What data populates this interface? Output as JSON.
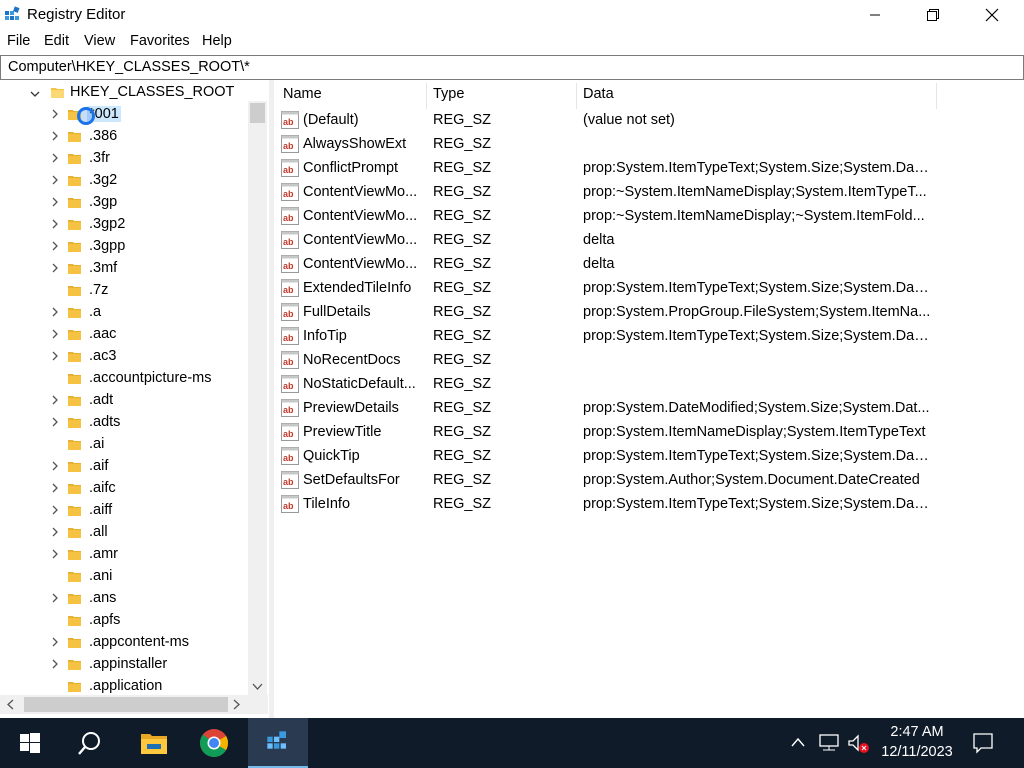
{
  "window": {
    "title": "Registry Editor"
  },
  "menu": [
    "File",
    "Edit",
    "View",
    "Favorites",
    "Help"
  ],
  "address": "Computer\\HKEY_CLASSES_ROOT\\*",
  "tree": {
    "root": "HKEY_CLASSES_ROOT",
    "items": [
      {
        "label": "*001",
        "expandable": true,
        "selected": true
      },
      {
        "label": ".386",
        "expandable": true
      },
      {
        "label": ".3fr",
        "expandable": true
      },
      {
        "label": ".3g2",
        "expandable": true
      },
      {
        "label": ".3gp",
        "expandable": true
      },
      {
        "label": ".3gp2",
        "expandable": true
      },
      {
        "label": ".3gpp",
        "expandable": true
      },
      {
        "label": ".3mf",
        "expandable": true
      },
      {
        "label": ".7z",
        "expandable": false
      },
      {
        "label": ".a",
        "expandable": true
      },
      {
        "label": ".aac",
        "expandable": true
      },
      {
        "label": ".ac3",
        "expandable": true
      },
      {
        "label": ".accountpicture-ms",
        "expandable": false
      },
      {
        "label": ".adt",
        "expandable": true
      },
      {
        "label": ".adts",
        "expandable": true
      },
      {
        "label": ".ai",
        "expandable": false
      },
      {
        "label": ".aif",
        "expandable": true
      },
      {
        "label": ".aifc",
        "expandable": true
      },
      {
        "label": ".aiff",
        "expandable": true
      },
      {
        "label": ".all",
        "expandable": true
      },
      {
        "label": ".amr",
        "expandable": true
      },
      {
        "label": ".ani",
        "expandable": false
      },
      {
        "label": ".ans",
        "expandable": true
      },
      {
        "label": ".apfs",
        "expandable": false
      },
      {
        "label": ".appcontent-ms",
        "expandable": true
      },
      {
        "label": ".appinstaller",
        "expandable": true
      },
      {
        "label": ".application",
        "expandable": false
      }
    ]
  },
  "columns": {
    "name": "Name",
    "type": "Type",
    "data": "Data"
  },
  "values": [
    {
      "name": "(Default)",
      "type": "REG_SZ",
      "data": "(value not set)"
    },
    {
      "name": "AlwaysShowExt",
      "type": "REG_SZ",
      "data": ""
    },
    {
      "name": "ConflictPrompt",
      "type": "REG_SZ",
      "data": "prop:System.ItemTypeText;System.Size;System.Date..."
    },
    {
      "name": "ContentViewMo...",
      "type": "REG_SZ",
      "data": "prop:~System.ItemNameDisplay;System.ItemTypeT..."
    },
    {
      "name": "ContentViewMo...",
      "type": "REG_SZ",
      "data": "prop:~System.ItemNameDisplay;~System.ItemFold..."
    },
    {
      "name": "ContentViewMo...",
      "type": "REG_SZ",
      "data": "delta"
    },
    {
      "name": "ContentViewMo...",
      "type": "REG_SZ",
      "data": "delta"
    },
    {
      "name": "ExtendedTileInfo",
      "type": "REG_SZ",
      "data": "prop:System.ItemTypeText;System.Size;System.Date..."
    },
    {
      "name": "FullDetails",
      "type": "REG_SZ",
      "data": "prop:System.PropGroup.FileSystem;System.ItemNa..."
    },
    {
      "name": "InfoTip",
      "type": "REG_SZ",
      "data": "prop:System.ItemTypeText;System.Size;System.Date..."
    },
    {
      "name": "NoRecentDocs",
      "type": "REG_SZ",
      "data": ""
    },
    {
      "name": "NoStaticDefault...",
      "type": "REG_SZ",
      "data": ""
    },
    {
      "name": "PreviewDetails",
      "type": "REG_SZ",
      "data": "prop:System.DateModified;System.Size;System.Dat..."
    },
    {
      "name": "PreviewTitle",
      "type": "REG_SZ",
      "data": "prop:System.ItemNameDisplay;System.ItemTypeText"
    },
    {
      "name": "QuickTip",
      "type": "REG_SZ",
      "data": "prop:System.ItemTypeText;System.Size;System.Date..."
    },
    {
      "name": "SetDefaultsFor",
      "type": "REG_SZ",
      "data": "prop:System.Author;System.Document.DateCreated"
    },
    {
      "name": "TileInfo",
      "type": "REG_SZ",
      "data": "prop:System.ItemTypeText;System.Size;System.Date..."
    }
  ],
  "taskbar": {
    "time": "2:47 AM",
    "date": "12/11/2023"
  },
  "colors": {
    "taskbar": "#101b2a",
    "folder": "#f5c242",
    "selection": "#cce8ff",
    "accent": "#1a73e8"
  }
}
